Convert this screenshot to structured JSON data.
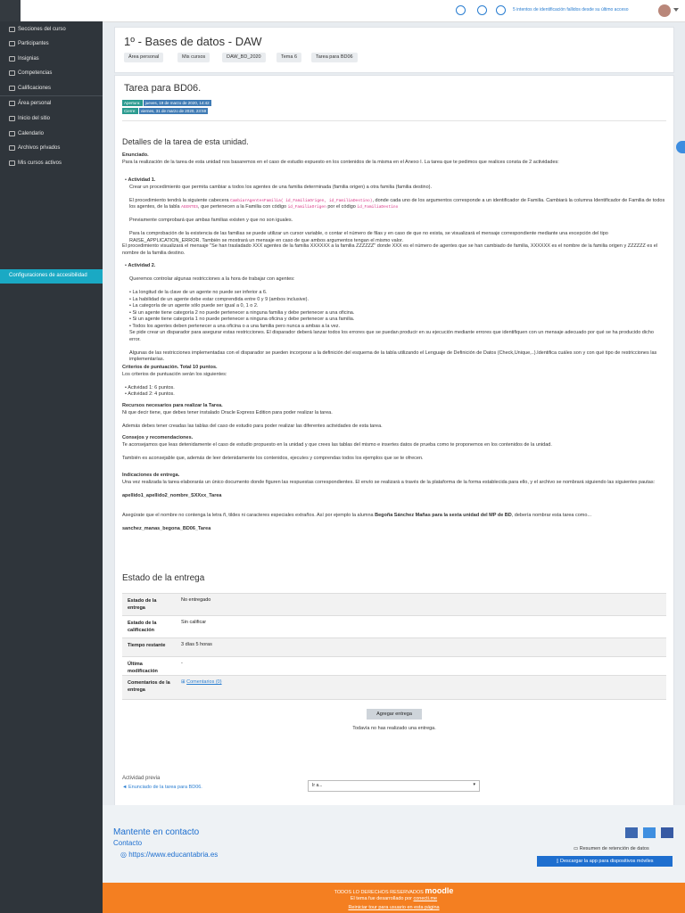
{
  "topbar": {
    "notice": "5 intentos de identificación fallidos desde su último acceso",
    "icons": [
      "menu-icon",
      "globe-icon",
      "bell-icon",
      "chat-icon"
    ]
  },
  "sidebar": {
    "items": [
      {
        "label": "Secciones del curso",
        "icon": "folder-icon"
      },
      {
        "label": "Participantes",
        "icon": "users-icon"
      },
      {
        "label": "Insignias",
        "icon": "badge-icon"
      },
      {
        "label": "Competencias",
        "icon": "check-square-icon"
      },
      {
        "label": "Calificaciones",
        "icon": "table-icon"
      },
      {
        "label": "Área personal",
        "icon": "home-icon"
      },
      {
        "label": "Inicio del sitio",
        "icon": "site-icon"
      },
      {
        "label": "Calendario",
        "icon": "calendar-icon"
      },
      {
        "label": "Archivos privados",
        "icon": "file-icon"
      },
      {
        "label": "Mis cursos activos",
        "icon": "graduation-icon"
      }
    ],
    "accessibility": "Configuraciones de accesibilidad"
  },
  "header": {
    "title": "1º - Bases de datos - DAW",
    "breadcrumb": [
      "Área personal",
      "Mis cursos",
      "DAW_BD_2020",
      "Tema 6",
      "Tarea para BD06"
    ]
  },
  "assignment": {
    "title": "Tarea para BD06.",
    "opened_label": "Apertura:",
    "opened_value": "jueves, 19 de marzo de 2020, 14:42",
    "due_label": "Cierre:",
    "due_value": "viernes, 31 de marzo de 2020, 23:59",
    "details_heading": "Detalles de la tarea de esta unidad.",
    "enunciado_head": "Enunciado.",
    "p1": "Para la realización de la tarea de esta unidad nos basaremos en el caso de estudio expuesto en los contenidos de la misma en el Anexo I. La tarea que te pedimos que realices consta de 2 actividades:",
    "act1": "Actividad 1.",
    "act1_p1": "Crear un procedimiento que permita cambiar a todos los agentes de una familia determinada (familia origen) a otra familia (familia destino).",
    "act1_p2a": "El procedimiento tendrá la siguiente cabecera ",
    "act1_code1": "CambiarAgentesFamilia( id_FamiliaOrigen, id_FamiliaDestino)",
    "act1_p2b": ", donde cada uno de los argumentos corresponde a un identificador de Familia. Cambiará la columna  Identificador de Familia de todos los agentes, de la tabla ",
    "act1_code2": "AGENTES",
    "act1_p2c": ", que pertenecen a la Familia con código ",
    "act1_code3": "id_FamiliaOrigen",
    "act1_p2d": " por el código ",
    "act1_code4": "id_FamiliaDestino",
    "act1_p3": "Previamente comprobará que ambas familias existen y que no son iguales.",
    "act1_p4": "Para la comprobación de la existencia de las familias se puede utilizar un cursor variable, o contar el número de filas y en caso de que no exista, se visualizará el mensaje correspondiente mediante una excepción del tipo RAISE_APPLICATION_ERROR. También se mostrará un mensaje en caso de que ambos argumentos tengan el mismo valor.",
    "act1_p5": "El procedimiento visualizará  el mensaje \"Se han trasladado XXX agentes de la familia  XXXXXX a la familia ZZZZZZ\" donde XXX es el número de agentes que se han cambiado de familia, XXXXXX es el nombre de la familia origen y ZZZZZZ es el nombre de la familia destino.",
    "act2": "Actividad 2.",
    "act2_p1": "Queremos controlar algunas restricciones a la hora de trabajar con agentes:",
    "act2_list": [
      "La longitud de la clave de un agente no puede ser inferior a 6.",
      "La habilidad de un agente debe estar comprendida entre 0 y 9 (ambos inclusive).",
      "La categoría de un agente sólo puede ser igual a 0, 1 o 2.",
      "Si un agente tiene categoría 2 no puede pertenecer a ninguna familia y debe pertenecer a una oficina.",
      "Si un agente tiene categoría 1 no puede pertenecer a ninguna oficina y debe pertenecer  a una familia.",
      "Todos los agentes deben pertenecer  a una oficina o a una familia pero nunca a ambas a la vez."
    ],
    "act2_p2": "Se pide crear un disparador para asegurar estas restricciones. El disparador deberá lanzar todos los errores que se puedan producir en su ejecución mediante errores que identifiquen con un mensaje adecuado por qué se ha producido dicho error.",
    "act2_p3": "Algunas de las restricciones implementadas con el disparador se pueden incorporar a la definición del esquema de la tabla utilizando el Lenguaje de Definición de Datos (Check,Unique,..).Identifica cuáles son y con qué tipo de restricciones las implementarías.",
    "criterios_head": "Criterios de puntuación. Total 10 puntos.",
    "criterios_p": "Los criterios de puntuación serán los siguientes:",
    "criterios_list": [
      "Actividad 1: 6 puntos.",
      "Actividad 2: 4 puntos."
    ],
    "recursos_head": "Recursos necesarios para realizar la Tarea.",
    "recursos_p1": "Ni que decir tiene, que debes tener instalado Oracle Express Edition para poder realizar la tarea.",
    "recursos_p2": "Además debes tener creadas las tablas del caso de estudio para poder realizar las diferentes actividades de esta tarea.",
    "consejos_head": "Consejos y recomendaciones.",
    "consejos_p1": "Te aconsejamos que leas detenidamente el caso de estudio propuesto en la unidad y que crees las tablas del mismo e insertes datos de prueba como te proponemos en los contenidos de la unidad.",
    "consejos_p2": "También es aconsejable que, además de leer detenidamente los contenidos, ejecutes y comprendas todos los ejemplos que se te ofrecen.",
    "indicaciones_head": "Indicaciones de entrega.",
    "indicaciones_p1": "Una vez realizada la tarea elaborarás un único documento donde figuren las respuestas correspondientes. El envío se realizará a través de la plataforma de la forma establecida para ello, y el archivo se nombrará siguiendo las siguientes pautas:",
    "filename_pattern": "apellido1_apellido2_nombre_SXXxx_Tarea",
    "indicaciones_p2a": "Asegúrate que el nombre no contenga la letra ñ, tildes ni caracteres especiales extraños. Así por ejemplo la alumna ",
    "indicaciones_p2b": "Begoña Sánchez Mañas para la sexta unidad del MP de BD",
    "indicaciones_p2c": ", debería nombrar esta tarea como...",
    "filename_example": "sanchez_manas_begona_BD06_Tarea"
  },
  "submission": {
    "heading": "Estado de la entrega",
    "rows": [
      {
        "key": "Estado de la entrega",
        "value": "No entregado"
      },
      {
        "key": "Estado de la calificación",
        "value": "Sin calificar"
      },
      {
        "key": "Tiempo restante",
        "value": "3 días 5 horas"
      },
      {
        "key": "Última modificación",
        "value": "-"
      },
      {
        "key": "Comentarios de la entrega",
        "value": "Comentarios (0)"
      }
    ],
    "add_button": "Agregar entrega",
    "no_submission": "Todavía no has realizado una entrega."
  },
  "nav": {
    "prev_label": "Actividad previa",
    "prev_link": "◄ Enunciado de la tarea para BD06.",
    "jump_placeholder": "Ir a..."
  },
  "footer": {
    "heading": "Mantente en contacto",
    "contact": "Contacto",
    "url": "https://www.educantabria.es",
    "retention": "Resumen de retención de datos",
    "app_button": "Descargar la app para dispositivos móviles",
    "rights": "TODOS LO DERECHOS RESERVADOS",
    "brand": "moodle",
    "developed": "El tema fue desarrollado por",
    "developer": "conecti.me",
    "tour": "Reiniciar tour para usuario en esta página"
  },
  "colors": {
    "sidebar": "#2f353b",
    "accent": "#1aa9c4",
    "link": "#2a7ed1",
    "footer_bar": "#f47f21"
  }
}
